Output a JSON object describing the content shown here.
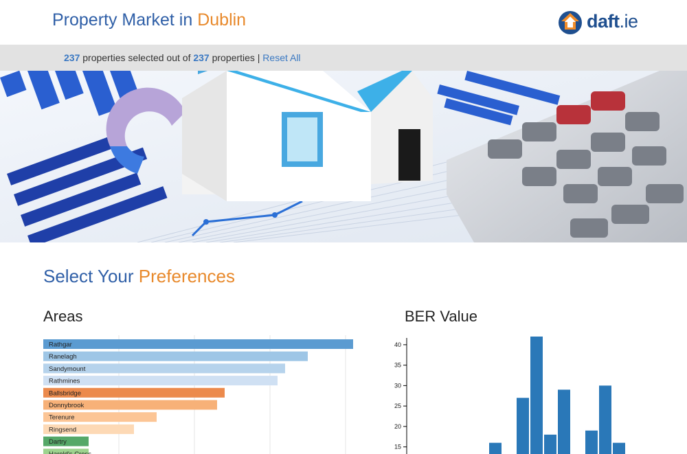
{
  "header": {
    "title_prefix": "Property Market in",
    "title_city": "Dublin",
    "logo_name": "daft",
    "logo_tld": ".ie",
    "logo_icon": "house-arrow-icon"
  },
  "status": {
    "selected": "237",
    "text1": "properties selected out of",
    "total": "237",
    "text2": "properties",
    "separator": "|",
    "reset_label": "Reset All"
  },
  "hero": {
    "image": "house-calculator-photo"
  },
  "preferences": {
    "heading_prefix": "Select Your",
    "heading_accent": "Preferences"
  },
  "areas": {
    "title": "Areas",
    "items": [
      {
        "label": "Rathgar",
        "value": 41,
        "color": "#5b9bd1"
      },
      {
        "label": "Ranelagh",
        "value": 35,
        "color": "#9ec6e6"
      },
      {
        "label": "Sandymount",
        "value": 32,
        "color": "#b6d3ec"
      },
      {
        "label": "Rathmines",
        "value": 31,
        "color": "#cfe0f3"
      },
      {
        "label": "Ballsbridge",
        "value": 24,
        "color": "#ec8a4c"
      },
      {
        "label": "Donnybrook",
        "value": 23,
        "color": "#f7b178"
      },
      {
        "label": "Terenure",
        "value": 15,
        "color": "#fcc595"
      },
      {
        "label": "Ringsend",
        "value": 12,
        "color": "#fdd9b5"
      },
      {
        "label": "Dartry",
        "value": 6,
        "color": "#55a868"
      },
      {
        "label": "Harold's Cross",
        "value": 6,
        "color": "#9dd38e"
      }
    ]
  },
  "chart_data": {
    "type": "bar",
    "title": "BER Value",
    "ylim": [
      14,
      42
    ],
    "y_ticks": [
      "15",
      "20",
      "25",
      "30",
      "35",
      "40"
    ],
    "values": [
      16,
      27,
      42,
      18,
      29,
      19,
      30,
      16
    ],
    "color": "#2a78b8"
  }
}
